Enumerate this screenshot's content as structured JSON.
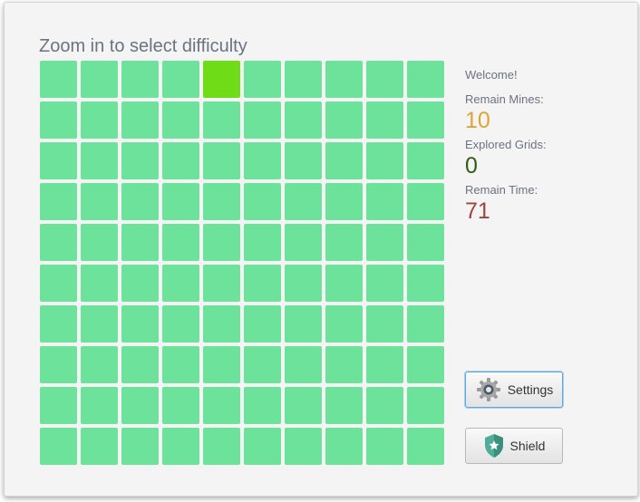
{
  "header": {
    "title": "Zoom in to select difficulty"
  },
  "board": {
    "rows": 10,
    "cols": 10,
    "cell_color": "#6ce29a",
    "highlight_color": "#6edc16",
    "highlighted_cell": {
      "row": 0,
      "col": 4
    }
  },
  "stats": {
    "welcome": "Welcome!",
    "remain_mines_label": "Remain Mines:",
    "remain_mines": "10",
    "explored_label": "Explored Grids:",
    "explored": "0",
    "remain_time_label": "Remain Time:",
    "remain_time": "71",
    "colors": {
      "mines": "#e0a436",
      "explored": "#2f5d12",
      "time": "#a0443c"
    }
  },
  "buttons": {
    "settings_label": "Settings",
    "settings_icon": "gear-icon",
    "shield_label": "Shield",
    "shield_icon": "shield-icon"
  }
}
